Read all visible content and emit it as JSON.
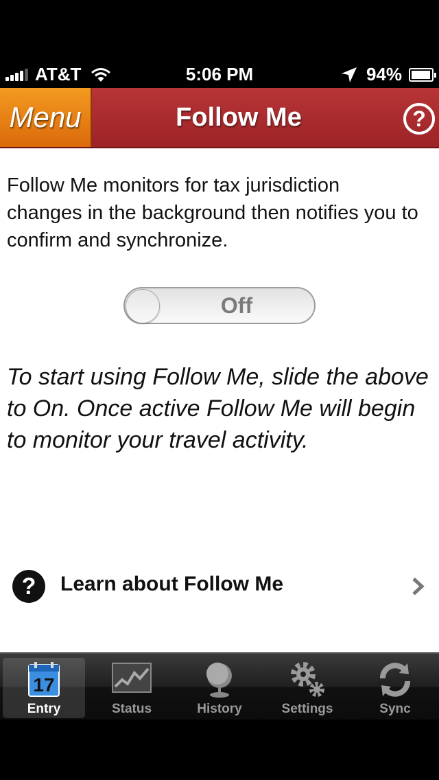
{
  "status_bar": {
    "carrier": "AT&T",
    "time": "5:06 PM",
    "battery_percent": "94%",
    "icons": [
      "signal-icon",
      "wifi-icon",
      "location-arrow-icon",
      "battery-charging-icon"
    ]
  },
  "nav": {
    "menu_label": "Menu",
    "title": "Follow Me",
    "help_label": "?"
  },
  "content": {
    "intro": "Follow Me monitors for tax jurisdiction changes in the background then notifies you to confirm and synchronize.",
    "toggle": {
      "state": "Off"
    },
    "instructions": "To start using Follow Me, slide the above to On. Once active Follow Me will begin to monitor your travel activity.",
    "learn": {
      "icon": "question-circle-icon",
      "label": "Learn about Follow Me"
    }
  },
  "tabs": [
    {
      "label": "Entry",
      "icon": "calendar-icon",
      "icon_text": "17",
      "active": true
    },
    {
      "label": "Status",
      "icon": "chart-icon",
      "active": false
    },
    {
      "label": "History",
      "icon": "globe-icon",
      "active": false
    },
    {
      "label": "Settings",
      "icon": "gears-icon",
      "active": false
    },
    {
      "label": "Sync",
      "icon": "sync-icon",
      "active": false
    }
  ],
  "colors": {
    "nav_red": "#a82b2d",
    "menu_orange": "#e8800f",
    "tab_bar": "#1c1c1c"
  }
}
